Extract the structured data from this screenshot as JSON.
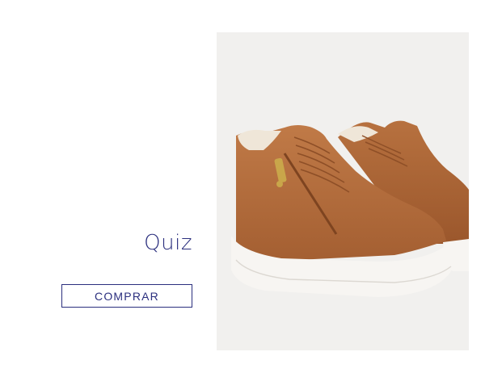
{
  "product": {
    "name": "Quiz",
    "buy_label": "COMPRAR",
    "image": {
      "subject": "brown-high-top-sneakers-icon",
      "colors": {
        "leather": "#b06a3b",
        "sole": "#f7f5f2",
        "lining": "#efe6d8",
        "zipper": "#c9a64a",
        "background": "#f1f0ee"
      }
    }
  },
  "accent_color": "#2b2f7e"
}
